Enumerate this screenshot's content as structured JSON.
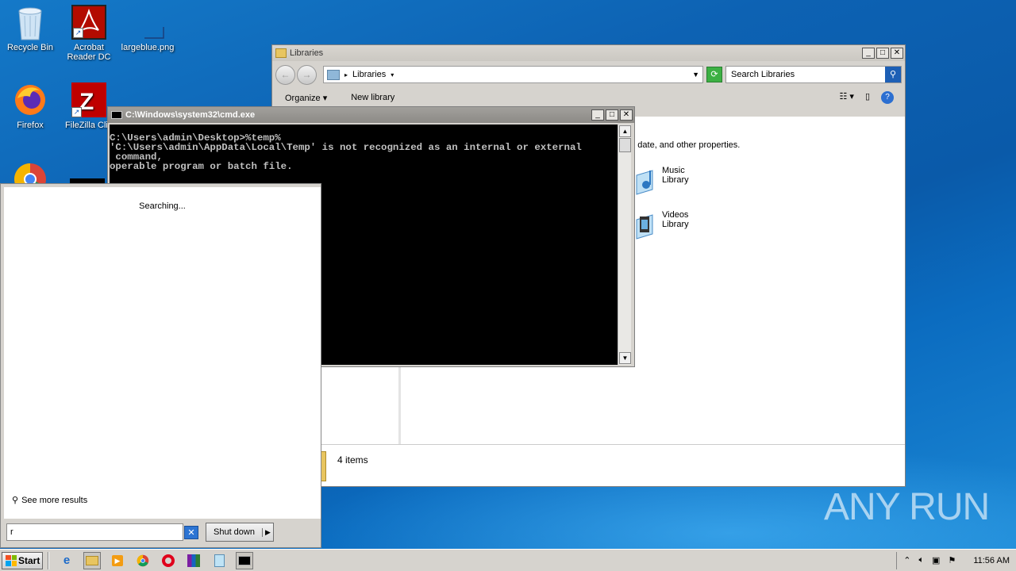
{
  "desktop": {
    "icons": [
      {
        "label": "Recycle Bin",
        "icon": "recycle-bin-icon"
      },
      {
        "label": "Acrobat Reader DC",
        "icon": "acrobat-icon"
      },
      {
        "label": "largeblue.png",
        "icon": "image-file-icon"
      },
      {
        "label": "Firefox",
        "icon": "firefox-icon"
      },
      {
        "label": "FileZilla Clie",
        "icon": "filezilla-icon"
      },
      {
        "label": "",
        "icon": "chrome-icon"
      }
    ]
  },
  "explorer": {
    "title": "Libraries",
    "address": "Libraries",
    "search_placeholder": "Search Libraries",
    "toolbar": {
      "organize": "Organize",
      "new_library": "New library"
    },
    "description": "er, date, and other properties.",
    "libraries": [
      {
        "line1": "Music",
        "line2": "Library"
      },
      {
        "line1": "Videos",
        "line2": "Library"
      }
    ],
    "status": "4 items"
  },
  "cmd": {
    "title": "C:\\Windows\\system32\\cmd.exe",
    "lines": [
      "C:\\Users\\admin\\Desktop>%temp%",
      "'C:\\Users\\admin\\AppData\\Local\\Temp' is not recognized as an internal or external",
      " command,",
      "operable program or batch file."
    ]
  },
  "start_menu": {
    "status": "Searching...",
    "see_more": "See more results",
    "search_value": "r",
    "shutdown": "Shut down"
  },
  "watermark": "ANY RUN",
  "taskbar": {
    "start": "Start",
    "clock": "11:56 AM",
    "apps": [
      "ie-icon",
      "explorer-icon",
      "media-player-icon",
      "chrome-icon",
      "opera-icon",
      "winrar-icon",
      "notepad-icon",
      "cmd-icon"
    ]
  },
  "colors": {
    "desktop": "#0d62b3",
    "cmd_bg": "#000000",
    "cmd_text": "#c0c0c0",
    "chrome_gray": "#d6d3ce"
  }
}
